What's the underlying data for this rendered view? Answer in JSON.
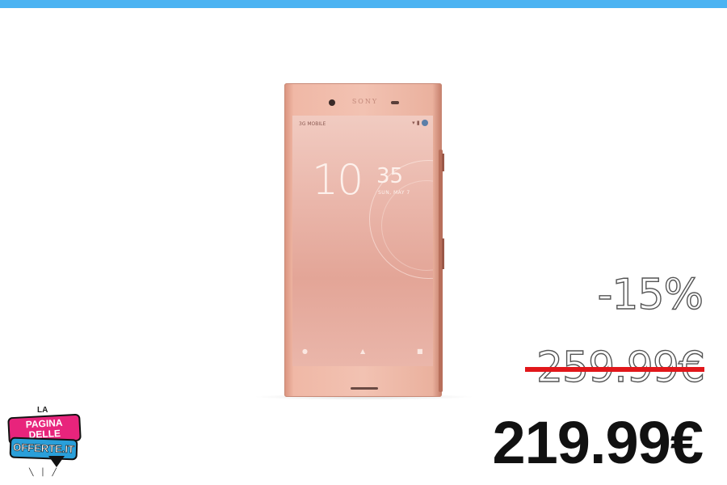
{
  "product": {
    "image_alt": "Sony smartphone",
    "brand_text": "SONY",
    "screen": {
      "status_left": "3G MOBILE",
      "clock_hour": "10",
      "clock_minute": "35",
      "date": "SUN, MAY 7"
    }
  },
  "pricing": {
    "discount": "-15%",
    "old_price": "259.99€",
    "new_price": "219.99€"
  },
  "logo": {
    "line1": "LA",
    "line2": "PAGINA DELLE",
    "line3": "OFFERTE.IT"
  },
  "colors": {
    "top_bar": "#4bb3f2",
    "strike": "#e1171b",
    "logo_pink": "#e8247c",
    "logo_blue": "#2a9fd9"
  }
}
